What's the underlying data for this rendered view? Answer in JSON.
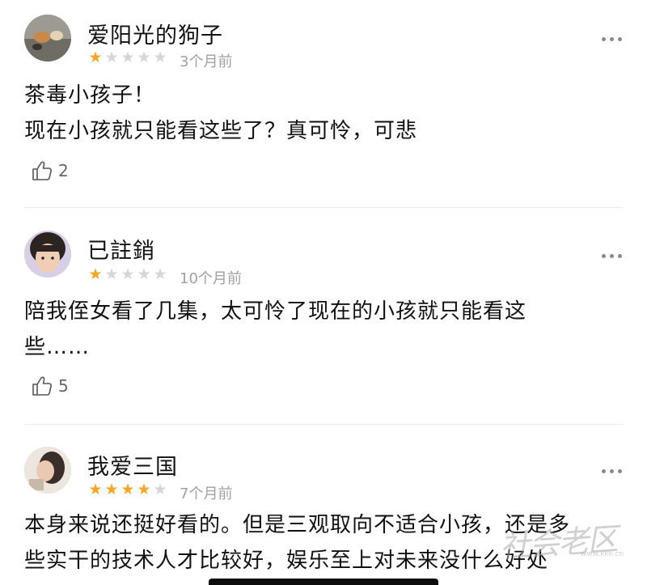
{
  "reviews": [
    {
      "username": "爱阳光的狗子",
      "rating": 1,
      "time": "3个月前",
      "content": [
        "茶毒小孩子！",
        "现在小孩就只能看这些了？真可怜，可悲"
      ],
      "likes": "2"
    },
    {
      "username": "已註銷",
      "rating": 1,
      "time": "10个月前",
      "content": [
        "陪我侄女看了几集，太可怜了现在的小孩就只能看这",
        "些……"
      ],
      "likes": "5"
    },
    {
      "username": "我爱三国",
      "rating": 4,
      "time": "7个月前",
      "content": [
        "本身来说还挺好看的。但是三观取向不适合小孩，还是多",
        "些实干的技术人才比较好，娱乐至上对未来没什么好处"
      ],
      "likes": ""
    }
  ],
  "watermark": "社会老区",
  "watermark_sub": "www.kkk.cn",
  "colors": {
    "star_on": "#f5a623",
    "star_off": "#d6d6d6",
    "meta": "#a0a0a0"
  },
  "icons": {
    "like": "thumbs-up-icon",
    "more": "more-dots-icon"
  }
}
